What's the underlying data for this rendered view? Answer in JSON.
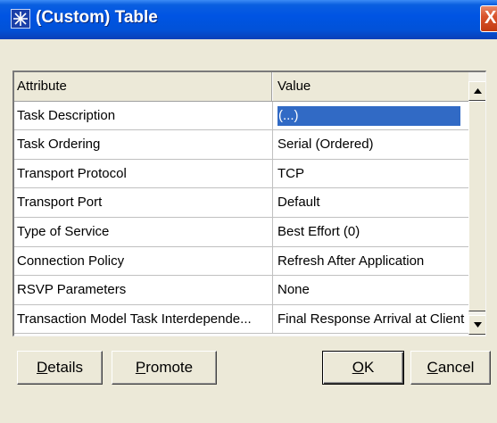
{
  "window": {
    "title": "(Custom) Table",
    "close_glyph": "X"
  },
  "table": {
    "headers": {
      "attribute": "Attribute",
      "value": "Value"
    },
    "rows": [
      {
        "attribute": "Task Description",
        "value": "(...)",
        "selected": true
      },
      {
        "attribute": "Task Ordering",
        "value": "Serial (Ordered)"
      },
      {
        "attribute": "Transport Protocol",
        "value": "TCP"
      },
      {
        "attribute": "Transport Port",
        "value": "Default"
      },
      {
        "attribute": "Type of Service",
        "value": "Best Effort (0)"
      },
      {
        "attribute": "Connection Policy",
        "value": "Refresh After Application"
      },
      {
        "attribute": "RSVP Parameters",
        "value": "None"
      },
      {
        "attribute": "Transaction Model Task Interdepende...",
        "value": "Final Response Arrival at Client"
      }
    ]
  },
  "buttons": {
    "details": {
      "mnemonic": "D",
      "rest": "etails"
    },
    "promote": {
      "mnemonic": "P",
      "rest": "romote"
    },
    "ok": {
      "mnemonic": "O",
      "rest": "K"
    },
    "cancel": {
      "mnemonic": "C",
      "rest": "ancel"
    }
  },
  "colors": {
    "titlebar": "#0054e3",
    "selection": "#316ac5",
    "dialog_bg": "#ece9d8",
    "close_button": "#d9542c"
  }
}
